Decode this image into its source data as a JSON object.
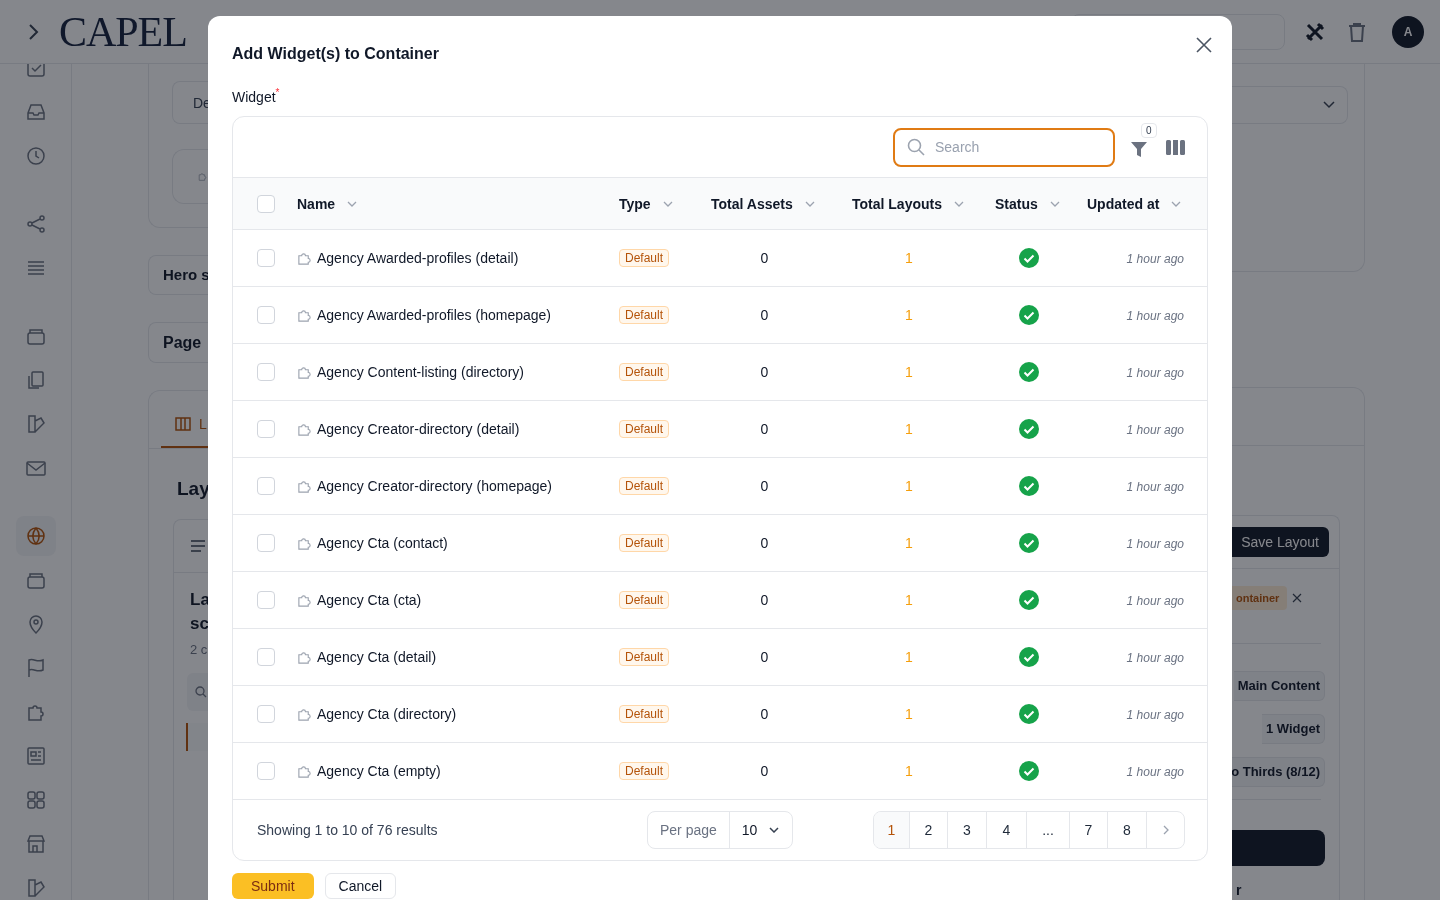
{
  "topbar": {
    "logo": "CAPEL",
    "avatar": "A"
  },
  "sidebar": {
    "items": [
      {
        "selected": false
      },
      {
        "selected": false
      },
      {
        "selected": false
      },
      {
        "selected": false
      },
      {
        "selected": false
      },
      {
        "selected": false
      },
      {
        "selected": false
      },
      {
        "selected": false
      },
      {
        "selected": false
      },
      {
        "selected": true
      },
      {
        "selected": false
      },
      {
        "selected": false
      },
      {
        "selected": false
      },
      {
        "selected": false
      },
      {
        "selected": false
      },
      {
        "selected": false
      },
      {
        "selected": false
      },
      {
        "selected": false
      }
    ]
  },
  "background": {
    "field_text": "De",
    "hero_card": "Hero s",
    "page_card": "Page",
    "tab": "L",
    "heading": "Lay",
    "card_title_1": "La",
    "card_title_2": "sc",
    "card_subtitle": "2 c",
    "save_button": "Save Layout",
    "badge": "ontainer",
    "pills": [
      "Main Content",
      "1 Widget",
      "o Thirds (8/12)"
    ],
    "bottom_text": "r"
  },
  "modal": {
    "title": "Add Widget(s) to Container",
    "field_label": "Widget",
    "required_mark": "*",
    "all_selected": false,
    "search": {
      "placeholder": "Search"
    },
    "filter_count": "0",
    "columns": [
      "Name",
      "Type",
      "Total Assets",
      "Total Layouts",
      "Status",
      "Updated at"
    ],
    "rows": [
      {
        "selected": false,
        "name": "Agency Awarded-profiles (detail)",
        "type": "Default",
        "total_assets": "0",
        "total_layouts": "1",
        "active": true,
        "updated": "1 hour ago"
      },
      {
        "selected": false,
        "name": "Agency Awarded-profiles (homepage)",
        "type": "Default",
        "total_assets": "0",
        "total_layouts": "1",
        "active": true,
        "updated": "1 hour ago"
      },
      {
        "selected": false,
        "name": "Agency Content-listing (directory)",
        "type": "Default",
        "total_assets": "0",
        "total_layouts": "1",
        "active": true,
        "updated": "1 hour ago"
      },
      {
        "selected": false,
        "name": "Agency Creator-directory (detail)",
        "type": "Default",
        "total_assets": "0",
        "total_layouts": "1",
        "active": true,
        "updated": "1 hour ago"
      },
      {
        "selected": false,
        "name": "Agency Creator-directory (homepage)",
        "type": "Default",
        "total_assets": "0",
        "total_layouts": "1",
        "active": true,
        "updated": "1 hour ago"
      },
      {
        "selected": false,
        "name": "Agency Cta (contact)",
        "type": "Default",
        "total_assets": "0",
        "total_layouts": "1",
        "active": true,
        "updated": "1 hour ago"
      },
      {
        "selected": false,
        "name": "Agency Cta (cta)",
        "type": "Default",
        "total_assets": "0",
        "total_layouts": "1",
        "active": true,
        "updated": "1 hour ago"
      },
      {
        "selected": false,
        "name": "Agency Cta (detail)",
        "type": "Default",
        "total_assets": "0",
        "total_layouts": "1",
        "active": true,
        "updated": "1 hour ago"
      },
      {
        "selected": false,
        "name": "Agency Cta (directory)",
        "type": "Default",
        "total_assets": "0",
        "total_layouts": "1",
        "active": true,
        "updated": "1 hour ago"
      },
      {
        "selected": false,
        "name": "Agency Cta (empty)",
        "type": "Default",
        "total_assets": "0",
        "total_layouts": "1",
        "active": true,
        "updated": "1 hour ago"
      }
    ],
    "summary": "Showing 1 to 10 of 76 results",
    "per_page_label": "Per page",
    "per_page": "10",
    "pages": [
      {
        "label": "1",
        "selected": true
      },
      {
        "label": "2",
        "selected": false
      },
      {
        "label": "3",
        "selected": false
      },
      {
        "label": "4",
        "selected": false
      },
      {
        "label": "...",
        "selected": false
      },
      {
        "label": "7",
        "selected": false
      },
      {
        "label": "8",
        "selected": false
      }
    ],
    "buttons": [
      "Submit",
      "Cancel"
    ]
  }
}
